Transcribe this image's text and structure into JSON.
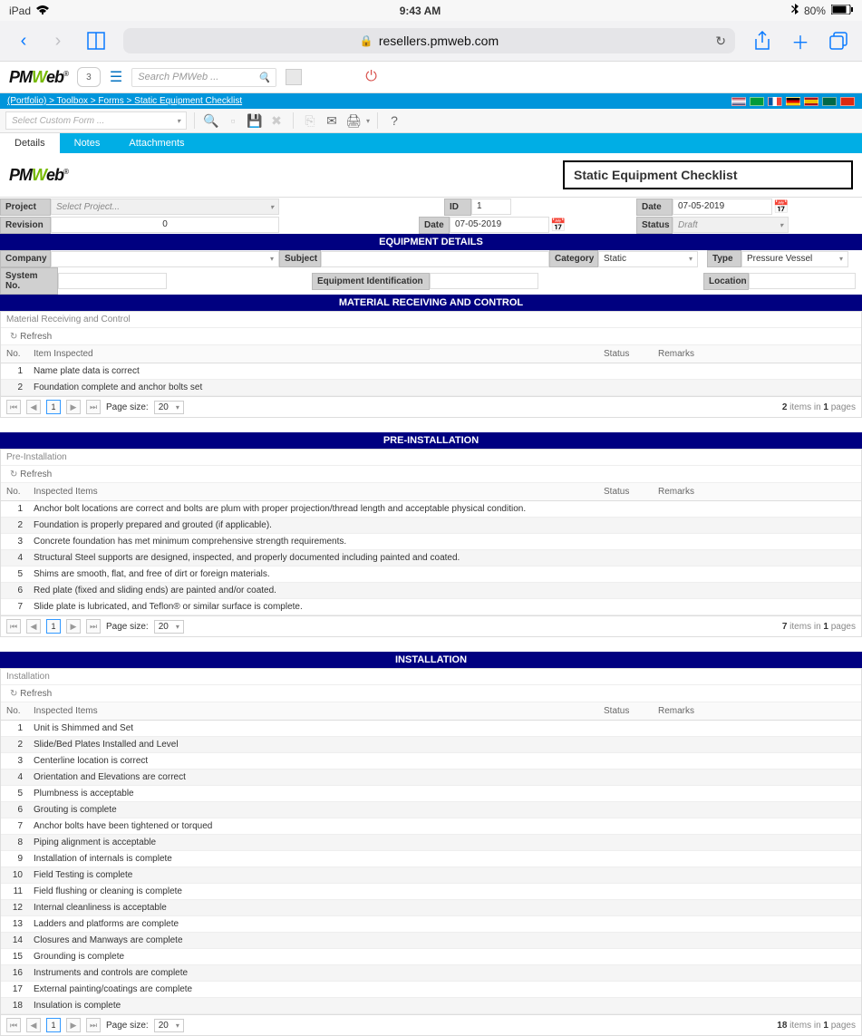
{
  "status_bar": {
    "device": "iPad",
    "time": "9:43 AM",
    "battery": "80%"
  },
  "safari": {
    "url": "resellers.pmweb.com"
  },
  "header": {
    "logo_text_pre": "PM",
    "logo_w": "W",
    "logo_text_post": "eb",
    "shield_count": "3",
    "search_placeholder": "Search PMWeb ..."
  },
  "breadcrumb": "(Portfolio) > Toolbox > Forms > Static Equipment Checklist",
  "custom_form_placeholder": "Select Custom Form ...",
  "tabs": {
    "details": "Details",
    "notes": "Notes",
    "attachments": "Attachments"
  },
  "content": {
    "title": "Static Equipment Checklist",
    "labels": {
      "project": "Project",
      "project_placeholder": "Select Project...",
      "revision": "Revision",
      "revision_value": "0",
      "id": "ID",
      "id_value": "1",
      "date": "Date",
      "date_value": "07-05-2019",
      "date2": "Date",
      "date2_value": "07-05-2019",
      "status": "Status",
      "status_value": "Draft",
      "company": "Company",
      "subject": "Subject",
      "category": "Category",
      "category_value": "Static",
      "type": "Type",
      "type_value": "Pressure Vessel",
      "system_no": "System No.",
      "equip_id": "Equipment Identification",
      "location": "Location"
    },
    "section_equip": "EQUIPMENT DETAILS",
    "section_material": "MATERIAL RECEIVING AND CONTROL",
    "section_preinstall": "PRE-INSTALLATION",
    "section_install": "INSTALLATION"
  },
  "grid1": {
    "title": "Material Receiving and Control",
    "refresh": "Refresh",
    "cols": {
      "no": "No.",
      "item": "Item Inspected",
      "status": "Status",
      "remarks": "Remarks"
    },
    "rows": [
      {
        "no": "1",
        "item": "Name plate data is correct"
      },
      {
        "no": "2",
        "item": "Foundation complete and anchor bolts set"
      }
    ],
    "pager_info_count": "2",
    "pager_info_pages": "1"
  },
  "grid2": {
    "title": "Pre-Installation",
    "refresh": "Refresh",
    "cols": {
      "no": "No.",
      "item": "Inspected Items",
      "status": "Status",
      "remarks": "Remarks"
    },
    "rows": [
      {
        "no": "1",
        "item": "Anchor bolt locations are correct and bolts are plum with proper projection/thread length and acceptable physical condition."
      },
      {
        "no": "2",
        "item": "Foundation is properly prepared and grouted (if applicable)."
      },
      {
        "no": "3",
        "item": "Concrete foundation has met minimum comprehensive strength requirements."
      },
      {
        "no": "4",
        "item": "Structural Steel supports are designed, inspected, and properly documented including painted and coated."
      },
      {
        "no": "5",
        "item": "Shims are smooth, flat, and free of dirt or foreign materials."
      },
      {
        "no": "6",
        "item": "Red plate (fixed and sliding ends) are painted and/or coated."
      },
      {
        "no": "7",
        "item": "Slide plate is lubricated, and Teflon® or similar surface is complete."
      }
    ],
    "pager_info_count": "7",
    "pager_info_pages": "1"
  },
  "grid3": {
    "title": "Installation",
    "refresh": "Refresh",
    "cols": {
      "no": "No.",
      "item": "Inspected Items",
      "status": "Status",
      "remarks": "Remarks"
    },
    "rows": [
      {
        "no": "1",
        "item": "Unit is Shimmed and Set"
      },
      {
        "no": "2",
        "item": "Slide/Bed Plates Installed and Level"
      },
      {
        "no": "3",
        "item": "Centerline location is correct"
      },
      {
        "no": "4",
        "item": "Orientation and Elevations are correct"
      },
      {
        "no": "5",
        "item": "Plumbness is acceptable"
      },
      {
        "no": "6",
        "item": "Grouting is complete"
      },
      {
        "no": "7",
        "item": "Anchor bolts have been tightened or torqued"
      },
      {
        "no": "8",
        "item": "Piping alignment is acceptable"
      },
      {
        "no": "9",
        "item": "Installation of internals is complete"
      },
      {
        "no": "10",
        "item": "Field Testing is complete"
      },
      {
        "no": "11",
        "item": "Field flushing or cleaning is complete"
      },
      {
        "no": "12",
        "item": "Internal cleanliness is acceptable"
      },
      {
        "no": "13",
        "item": "Ladders and platforms are complete"
      },
      {
        "no": "14",
        "item": "Closures and Manways are complete"
      },
      {
        "no": "15",
        "item": "Grounding is complete"
      },
      {
        "no": "16",
        "item": "Instruments and controls are complete"
      },
      {
        "no": "17",
        "item": "External painting/coatings are complete"
      },
      {
        "no": "18",
        "item": "Insulation is complete"
      }
    ],
    "pager_info_count": "18",
    "pager_info_pages": "1"
  },
  "pager_labels": {
    "page_size": "Page size:",
    "page_size_val": "20",
    "one": "1",
    "items_in": "items in",
    "pages": "pages"
  }
}
